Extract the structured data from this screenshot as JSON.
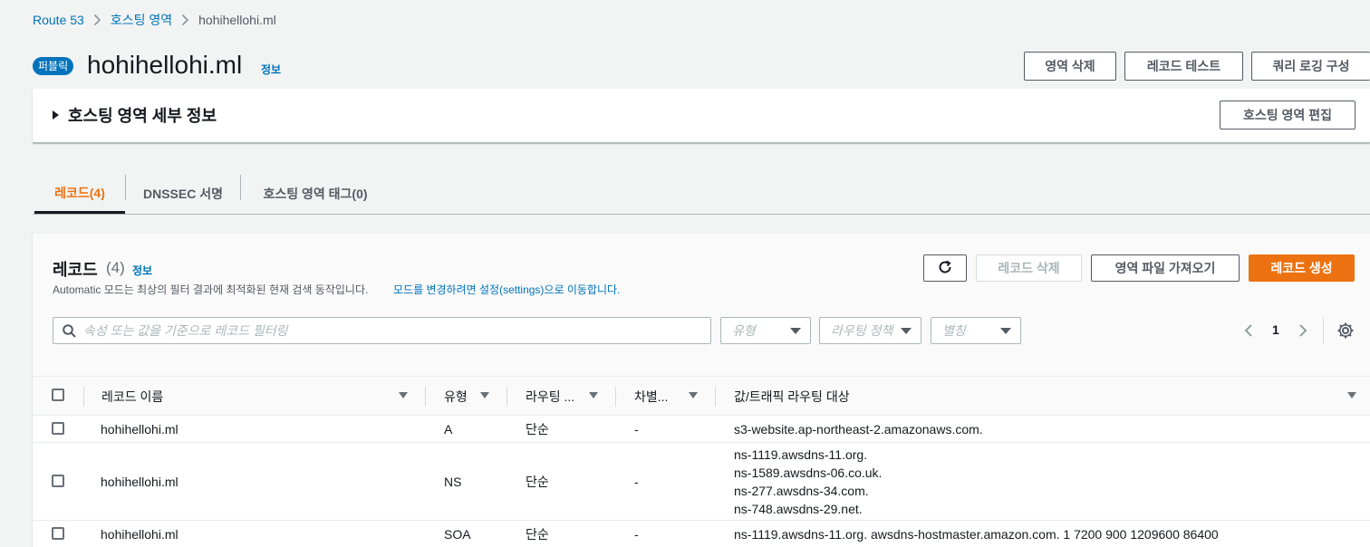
{
  "breadcrumb": {
    "items": [
      "Route 53",
      "호스팅 영역",
      "hohihellohi.ml"
    ]
  },
  "header": {
    "badge": "퍼블릭",
    "title": "hohihellohi.ml",
    "info": "정보",
    "buttons": {
      "delete_zone": "영역 삭제",
      "test_record": "레코드 테스트",
      "query_logging": "쿼리 로깅 구성"
    }
  },
  "details": {
    "title": "호스팅 영역 세부 정보",
    "edit_button": "호스팅 영역 편집"
  },
  "tabs": [
    {
      "label": "레코드(4)",
      "active": true
    },
    {
      "label": "DNSSEC 서명",
      "active": false
    },
    {
      "label": "호스팅 영역 태그(0)",
      "active": false
    }
  ],
  "records": {
    "title": "레코드",
    "count": "(4)",
    "info": "정보",
    "description": "Automatic 모드는 최상의 필터 결과에 최적화된 현재 검색 동작입니다.",
    "description_link": "모드를 변경하려면 설정(settings)으로 이동합니다.",
    "buttons": {
      "delete": "레코드 삭제",
      "import": "영역 파일 가져오기",
      "create": "레코드 생성"
    },
    "search_placeholder": "속성 또는 값을 기준으로 레코드 필터링",
    "filters": {
      "type": "유형",
      "routing": "라우팅 정책",
      "alias": "별칭"
    },
    "page": "1",
    "columns": {
      "name": "레코드 이름",
      "type": "유형",
      "routing": "라우팅 ...",
      "diff": "차별...",
      "value": "값/트래픽 라우팅 대상"
    },
    "rows": [
      {
        "name": "hohihellohi.ml",
        "type": "A",
        "routing": "단순",
        "diff": "-",
        "values": [
          "s3-website.ap-northeast-2.amazonaws.com."
        ]
      },
      {
        "name": "hohihellohi.ml",
        "type": "NS",
        "routing": "단순",
        "diff": "-",
        "values": [
          "ns-1119.awsdns-11.org.",
          "ns-1589.awsdns-06.co.uk.",
          "ns-277.awsdns-34.com.",
          "ns-748.awsdns-29.net."
        ]
      },
      {
        "name": "hohihellohi.ml",
        "type": "SOA",
        "routing": "단순",
        "diff": "-",
        "values": [
          "ns-1119.awsdns-11.org. awsdns-hostmaster.amazon.com. 1 7200 900 1209600 86400"
        ]
      }
    ]
  },
  "colors": {
    "link": "#0073bb",
    "accent": "#ec7211",
    "background": "#f2f3f3"
  }
}
